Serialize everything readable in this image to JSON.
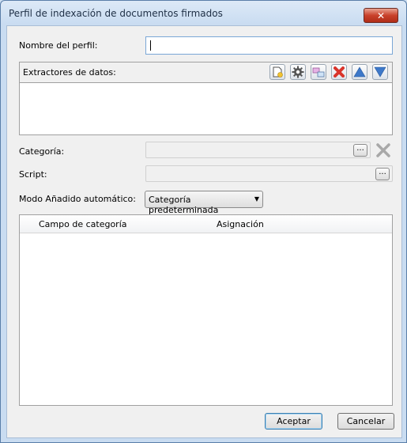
{
  "window": {
    "title": "Perfil de indexación de documentos firmados",
    "close_glyph": "✕"
  },
  "form": {
    "profile_name_label": "Nombre del perfil:",
    "profile_name_value": "",
    "extractors_label": "Extractores de datos:",
    "toolbar_icons": [
      "new-document-icon",
      "gear-icon",
      "window-link-icon",
      "delete-x-icon",
      "move-up-triangle-icon",
      "move-down-triangle-icon"
    ],
    "category_label": "Categoría:",
    "script_label": "Script:",
    "ellipsis": "...",
    "mode_label": "Modo Añadido automático:",
    "mode_value": "Categoría predeterminada",
    "mode_arrow": "▼",
    "table_columns": [
      "Campo de categoría",
      "Asignación"
    ],
    "table_rows": []
  },
  "buttons": {
    "accept": "Aceptar",
    "cancel": "Cancelar"
  },
  "colors": {
    "accent": "#7aa7d6",
    "delete": "#d9342b",
    "arrow": "#3d78c9",
    "close": "#c9412b"
  }
}
